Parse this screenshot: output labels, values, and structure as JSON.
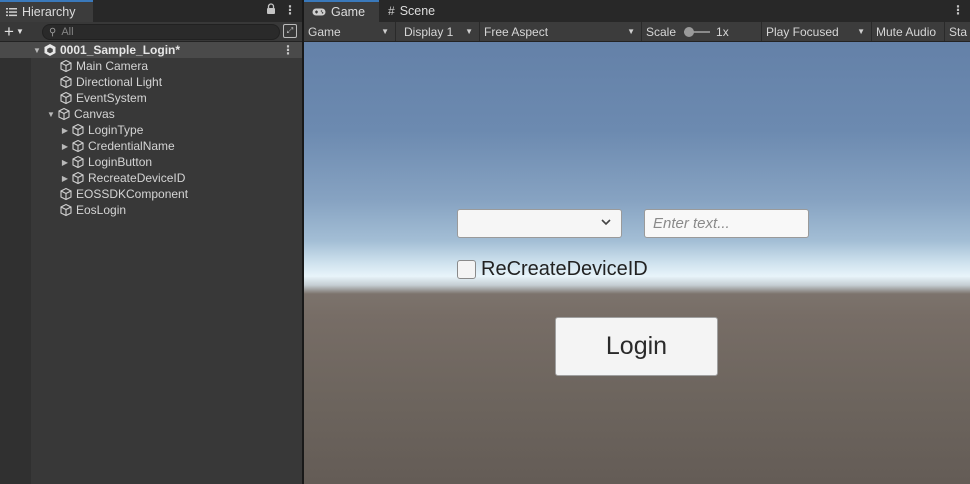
{
  "hierarchy": {
    "tab_label": "Hierarchy",
    "icons": [
      "list-icon",
      "lock-icon",
      "more-vert-icon"
    ],
    "search": {
      "placeholder": "All",
      "value": ""
    },
    "scene": {
      "name": "0001_Sample_Login*",
      "expanded": true
    },
    "items": [
      {
        "label": "Main Camera",
        "depth": 1,
        "has_children": false
      },
      {
        "label": "Directional Light",
        "depth": 1,
        "has_children": false
      },
      {
        "label": "EventSystem",
        "depth": 1,
        "has_children": false
      },
      {
        "label": "Canvas",
        "depth": 1,
        "has_children": true,
        "expanded": true
      },
      {
        "label": "LoginType",
        "depth": 2,
        "has_children": true,
        "expanded": false
      },
      {
        "label": "CredentialName",
        "depth": 2,
        "has_children": true,
        "expanded": false
      },
      {
        "label": "LoginButton",
        "depth": 2,
        "has_children": true,
        "expanded": false
      },
      {
        "label": "RecreateDeviceID",
        "depth": 2,
        "has_children": true,
        "expanded": false
      },
      {
        "label": "EOSSDKComponent",
        "depth": 1,
        "has_children": false
      },
      {
        "label": "EosLogin",
        "depth": 1,
        "has_children": false
      }
    ]
  },
  "game_panel": {
    "tabs": [
      {
        "label": "Game",
        "active": true,
        "icon": "gamepad-icon"
      },
      {
        "label": "Scene",
        "active": false,
        "icon": "grid-icon"
      }
    ],
    "toolbar": {
      "view_mode": "Game",
      "display": "Display 1",
      "aspect": "Free Aspect",
      "scale_label": "Scale",
      "scale_value": "1x",
      "play_mode": "Play Focused",
      "mute_audio": "Mute Audio",
      "stats": "Sta"
    },
    "viewport": {
      "dropdown_value": "",
      "input_placeholder": "Enter text...",
      "input_value": "",
      "checkbox_label": "ReCreateDeviceID",
      "checkbox_checked": false,
      "login_button": "Login"
    }
  },
  "colors": {
    "accent_tab": "#3a79bb",
    "panel_bg": "#383838",
    "toolbar_bg": "#3c3c3c",
    "tabbar_bg": "#282828"
  }
}
